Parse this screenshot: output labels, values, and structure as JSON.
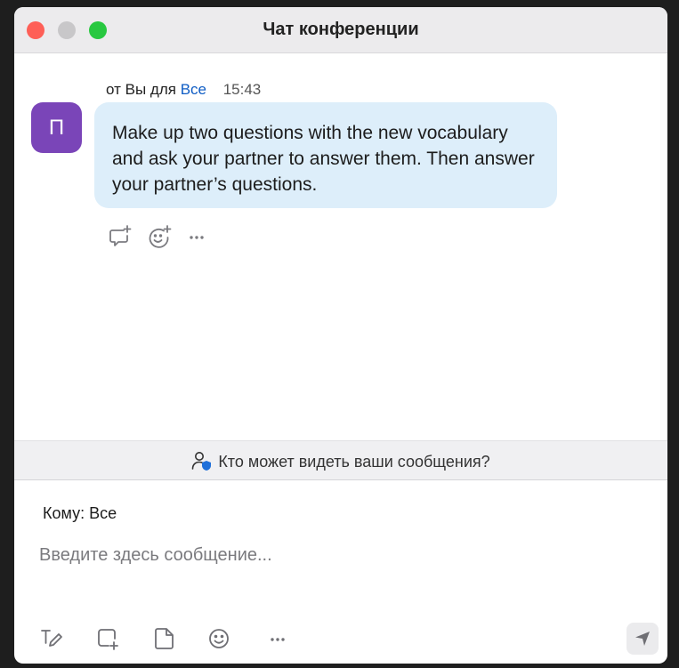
{
  "window": {
    "title": "Чат конференции"
  },
  "message": {
    "from_prefix": "от",
    "sender": "Вы",
    "for_word": "для",
    "recipient": "Все",
    "time": "15:43",
    "avatar_letter": "П",
    "text": "Make up two questions with the new vocabulary and ask your partner to answer them. Then answer your partner’s questions.",
    "actions": [
      "reply-icon",
      "add-reaction-icon",
      "more-icon"
    ]
  },
  "visibility": {
    "label": "Кто может видеть ваши сообщения?"
  },
  "compose": {
    "to_label": "Кому:",
    "to_value": "Все",
    "placeholder": "Введите здесь сообщение...",
    "toolbar": [
      "format-text-icon",
      "screenshot-icon",
      "file-icon",
      "emoji-icon",
      "more-icon"
    ],
    "send_icon": "send-icon"
  },
  "colors": {
    "bubble": "#ddeefa",
    "avatar": "#7a45b8",
    "link": "#0e5cc4",
    "close": "#fe5f57",
    "minimize": "#c8c7c9",
    "maximize": "#28c840"
  }
}
